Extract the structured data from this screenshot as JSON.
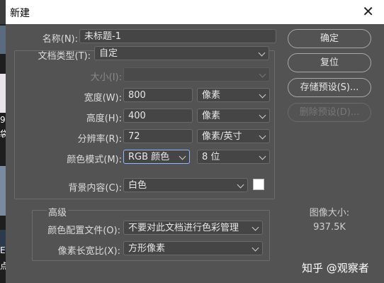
{
  "window": {
    "title": "新建",
    "close_icon": "close-icon"
  },
  "background_strip": {
    "texts": [
      "9",
      "袋",
      "E",
      "点"
    ]
  },
  "form": {
    "name": {
      "label": "名称(N):",
      "value": "未标题-1"
    },
    "doc_type": {
      "label": "文档类型(T):",
      "value": "自定"
    },
    "size": {
      "label": "大小(I):",
      "value": ""
    },
    "width": {
      "label": "宽度(W):",
      "value": "800",
      "unit": "像素"
    },
    "height": {
      "label": "高度(H):",
      "value": "400",
      "unit": "像素"
    },
    "resolution": {
      "label": "分辨率(R):",
      "value": "72",
      "unit": "像素/英寸"
    },
    "color_mode": {
      "label": "颜色模式(M):",
      "value": "RGB 颜色",
      "depth": "8 位"
    },
    "background": {
      "label": "背景内容(C):",
      "value": "白色",
      "swatch_color": "#ffffff"
    }
  },
  "advanced": {
    "title": "高级",
    "color_profile": {
      "label": "颜色配置文件(O):",
      "value": "不要对此文档进行色彩管理"
    },
    "pixel_aspect": {
      "label": "像素长宽比(X):",
      "value": "方形像素"
    }
  },
  "buttons": {
    "ok": "确定",
    "reset": "复位",
    "save_preset": "存储预设(S)...",
    "delete_preset": "删除预设(D)..."
  },
  "image_size": {
    "label": "图像大小:",
    "value": "937.5K"
  },
  "watermark": "知乎 @观察者"
}
